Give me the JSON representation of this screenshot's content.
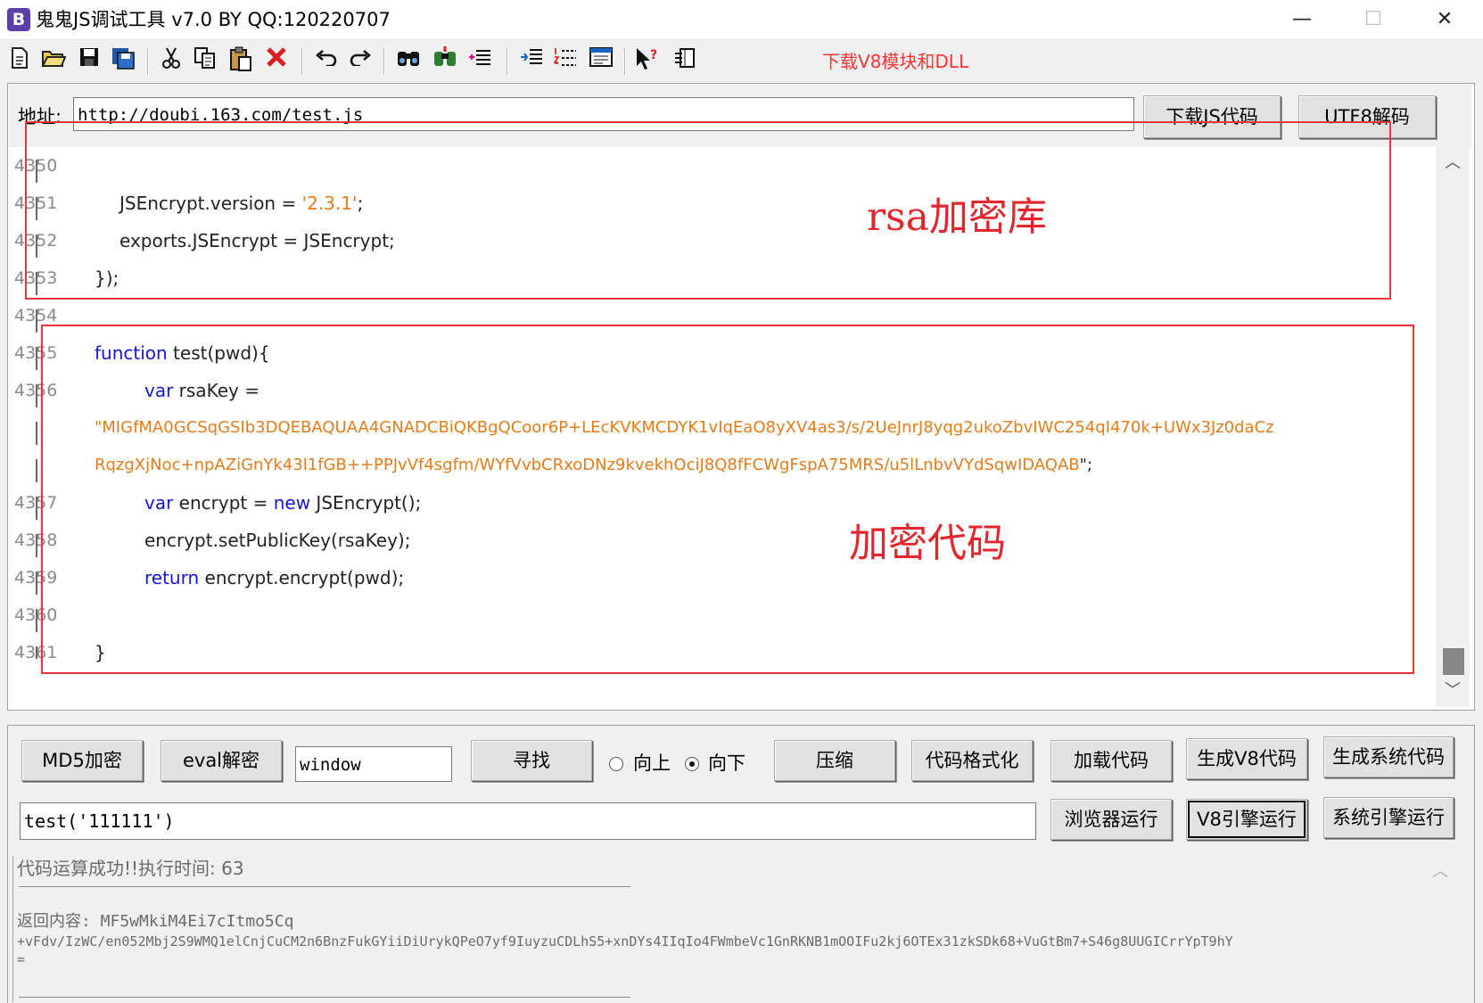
{
  "window": {
    "title": "鬼鬼JS调试工具 v7.0 BY QQ:120220707",
    "logo_letter": "B",
    "minimize": "—",
    "maximize": "☐",
    "close": "✕"
  },
  "toolbar": {
    "icons": [
      "new-file-icon",
      "open-folder-icon",
      "save-icon",
      "save-all-icon",
      "cut-icon",
      "copy-icon",
      "paste-icon",
      "delete-icon",
      "undo-icon",
      "redo-icon",
      "find-icon",
      "find-next-icon",
      "indent-list-icon",
      "outdent-icon",
      "numbered-list-icon",
      "window-icon",
      "help-pointer-icon",
      "panel-icon"
    ],
    "download_link": "下载V8模块和DLL",
    "link_color": "#ff3333"
  },
  "address": {
    "label": "地址:",
    "value": "http://doubi.163.com/test.js",
    "download_button": "下载JS代码",
    "utf8_button": "UTF8解码"
  },
  "code": {
    "lines": [
      {
        "num": "4350",
        "text": ""
      },
      {
        "num": "4351",
        "pre": "JSEncrypt.version = ",
        "str": "'2.3.1'",
        "post": ";"
      },
      {
        "num": "4352",
        "text": "exports.JSEncrypt = JSEncrypt;"
      },
      {
        "num": "4353",
        "text": "});"
      },
      {
        "num": "4354",
        "text": ""
      },
      {
        "num": "4355",
        "kw": "function",
        "post": " test(pwd){"
      },
      {
        "num": "4356",
        "kw": "var",
        "post": " rsaKey ="
      },
      {
        "num": "",
        "str": "\"MIGfMA0GCSqGSIb3DQEBAQUAA4GNADCBiQKBgQCoor6P+LEcKVKMCDYK1vIqEaO8yXV4as3/s/2UeJnrJ8yqg2ukoZbvIWC254qI470k+UWx3Jz0daCz"
      },
      {
        "num": "",
        "str": "RqzgXjNoc+npAZiGnYk43l1fGB++PPJvVf4sgfm/WYfVvbCRxoDNz9kvekhOciJ8Q8fFCWgFspA75MRS/u5lLnbvVYdSqwIDAQAB",
        "post": "\";"
      },
      {
        "num": "4357",
        "kw": "var",
        "post": " encrypt = ",
        "kw2": "new",
        "post2": " JSEncrypt();"
      },
      {
        "num": "4358",
        "text": "encrypt.setPublicKey(rsaKey);"
      },
      {
        "num": "4359",
        "kw": "return",
        "post": " encrypt.encrypt(pwd);"
      },
      {
        "num": "4360",
        "text": ""
      },
      {
        "num": "4361",
        "text": "}"
      }
    ],
    "keyword_color": "#1515d8",
    "string_color": "#e57c1b"
  },
  "annotations": {
    "rsa_label": "rsa加密库",
    "encrypt_label": "加密代码",
    "color": "#e8363d"
  },
  "controls": {
    "md5_button": "MD5加密",
    "eval_button": "eval解密",
    "find_value": "window",
    "find_button": "寻找",
    "radio_up": "向上",
    "radio_down": "向下",
    "compress_button": "压缩",
    "format_button": "代码格式化",
    "load_button": "加载代码",
    "gen_v8_button": "生成V8代码",
    "gen_sys_button": "生成系统代码",
    "command_value": "test('111111')",
    "browser_run_button": "浏览器运行",
    "v8_run_button": "V8引擎运行",
    "sys_run_button": "系统引擎运行"
  },
  "output": {
    "status": "代码运算成功!!执行时间: 63",
    "result_label": "返回内容: MF5wMkiM4Ei7cItmo5Cq",
    "result_line2": "+vFdv/IzWC/en052Mbj2S9WMQ1elCnjCuCM2n6BnzFukGYiiDiUrykQPeO7yf9IuyzuCDLhS5+xnDYs4IIqIo4FWmbeVc1GnRKNB1mOOIFu2kj6OTEx31zkSDk68+VuGtBm7+S46g8UUGICrrYpT9hY",
    "result_line3": "="
  }
}
